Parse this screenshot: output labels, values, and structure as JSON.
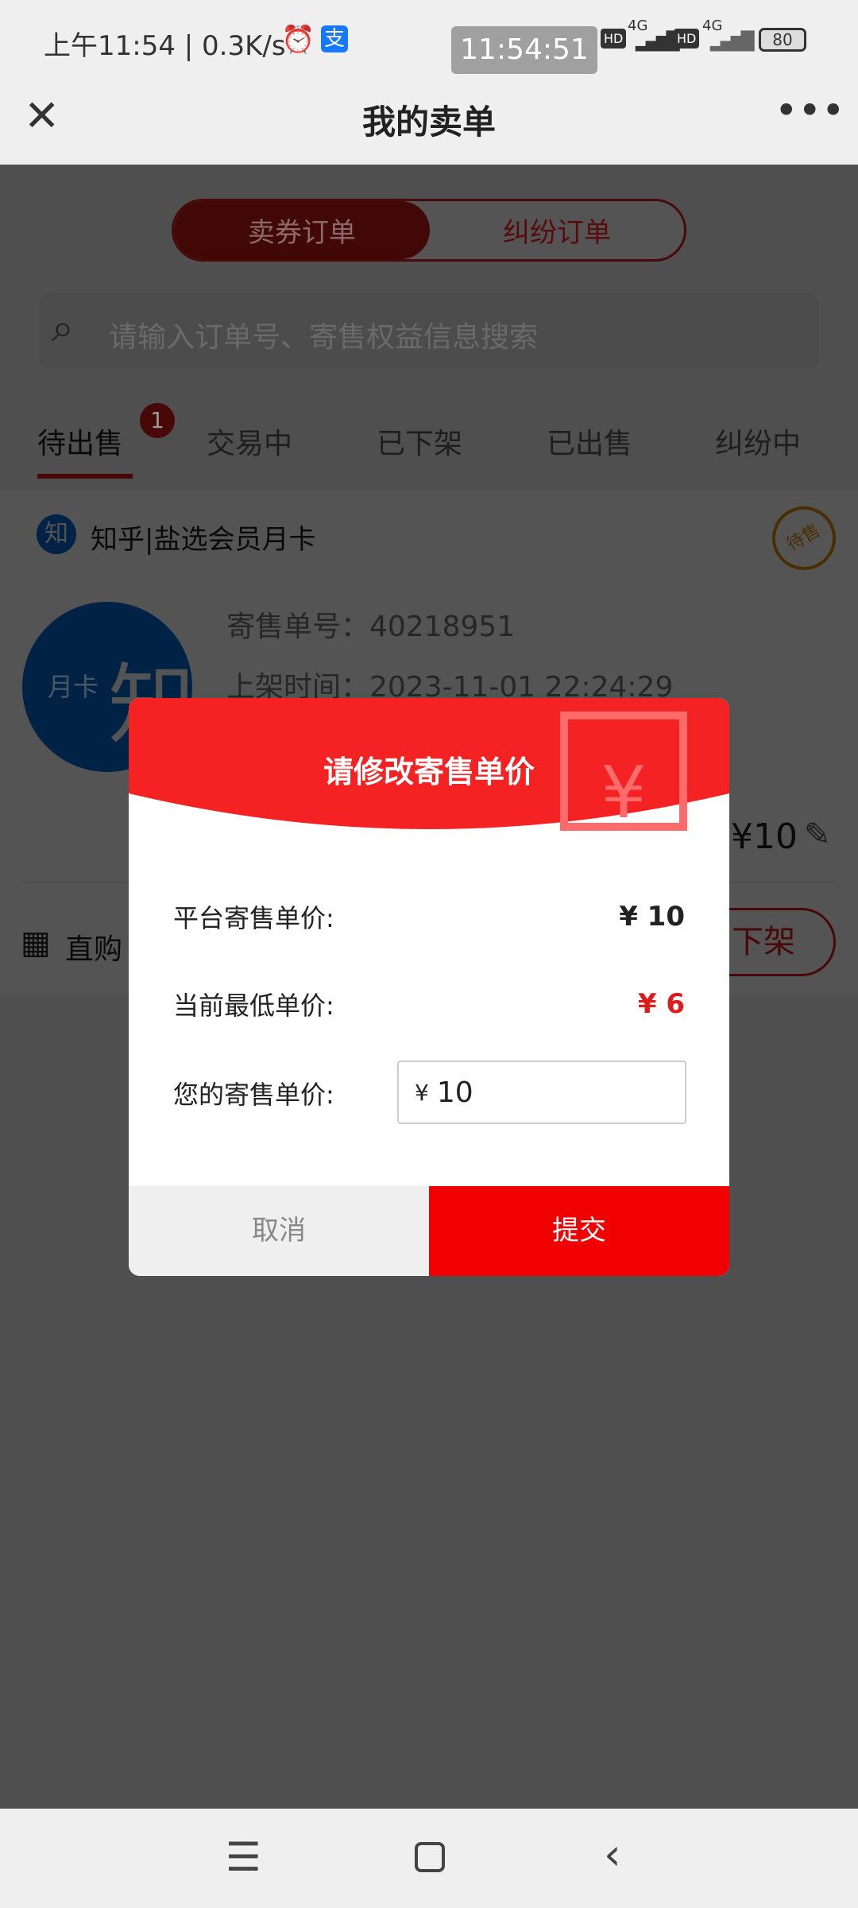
{
  "status_bar": {
    "time": "上午11:54 | 0.3K/s",
    "clock_overlay": "11:54:51",
    "net1": "4G",
    "net2": "4G",
    "hd": "HD",
    "battery": "80"
  },
  "header": {
    "title": "我的卖单"
  },
  "segment": {
    "items": [
      "卖券订单",
      "纠纷订单"
    ],
    "active": 0
  },
  "search": {
    "placeholder": "请输入订单号、寄售权益信息搜索"
  },
  "tabs": [
    {
      "label": "待出售",
      "badge": "1"
    },
    {
      "label": "交易中"
    },
    {
      "label": "已下架"
    },
    {
      "label": "已出售"
    },
    {
      "label": "纠纷中"
    }
  ],
  "card": {
    "brand_icon": "知",
    "title": "知乎|盐选会员月卡",
    "stamp": "待售",
    "avatar_text": "月卡",
    "avatar_big": "知",
    "order_no": "寄售单号：40218951",
    "listed_time": "上架时间：2023-11-01 22:24:29",
    "price": "¥10",
    "buy_label": "直购",
    "delist": "下架"
  },
  "modal": {
    "title": "请修改寄售单价",
    "platform_label": "平台寄售单价:",
    "platform_value": "¥ 10",
    "lowest_label": "当前最低单价:",
    "lowest_value": "¥ 6",
    "yours_label": "您的寄售单价:",
    "currency": "¥",
    "yours_value": "10",
    "cancel": "取消",
    "submit": "提交"
  },
  "colors": {
    "accent": "#f00000",
    "brand": "#c8171e"
  }
}
